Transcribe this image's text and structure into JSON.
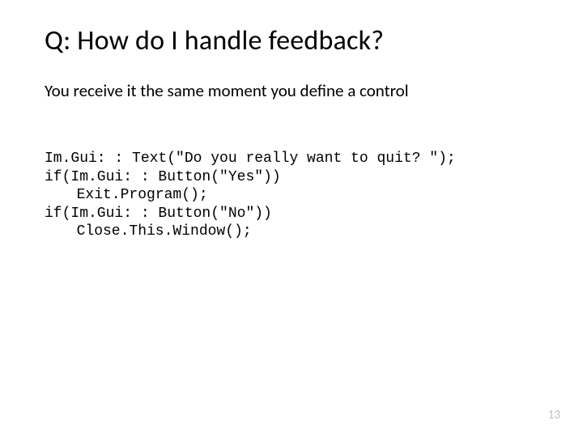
{
  "title": "Q: How do I handle feedback?",
  "subtitle": "You receive it the same moment you define a control",
  "code": {
    "l1": "Im.Gui: : Text(\"Do you really want to quit? \");",
    "l2": "if(Im.Gui: : Button(\"Yes\"))",
    "l3": "Exit.Program();",
    "l4": "if(Im.Gui: : Button(\"No\"))",
    "l5": "Close.This.Window();"
  },
  "page_number": "13"
}
